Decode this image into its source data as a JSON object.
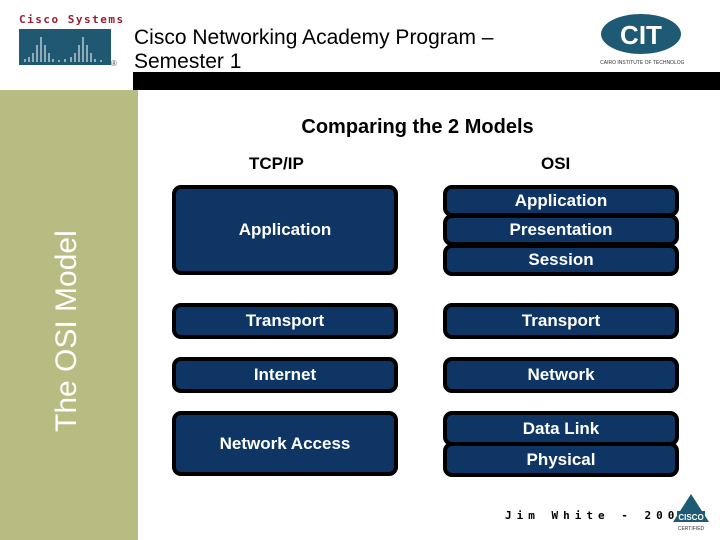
{
  "header": {
    "logo_left": "Cisco Systems",
    "title": "Cisco Networking Academy Program – Semester 1",
    "title_line1": "Cisco Networking Academy Program –",
    "title_line2": "Semester 1",
    "logo_right": "CIT"
  },
  "sidebar": {
    "label": "The OSI Model",
    "color": "#b8bc82"
  },
  "slide": {
    "heading": "Comparing the 2 Models",
    "tcpip": {
      "label": "TCP/IP",
      "layers": [
        "Application",
        "Transport",
        "Internet",
        "Network Access"
      ]
    },
    "osi": {
      "label": "OSI",
      "layers": [
        "Application",
        "Presentation",
        "Session",
        "Transport",
        "Network",
        "Data Link",
        "Physical"
      ]
    },
    "box_color": "#0e3563"
  },
  "footer": {
    "author": "Jim White - 2002",
    "badge": "CCNA Cisco Certified"
  }
}
